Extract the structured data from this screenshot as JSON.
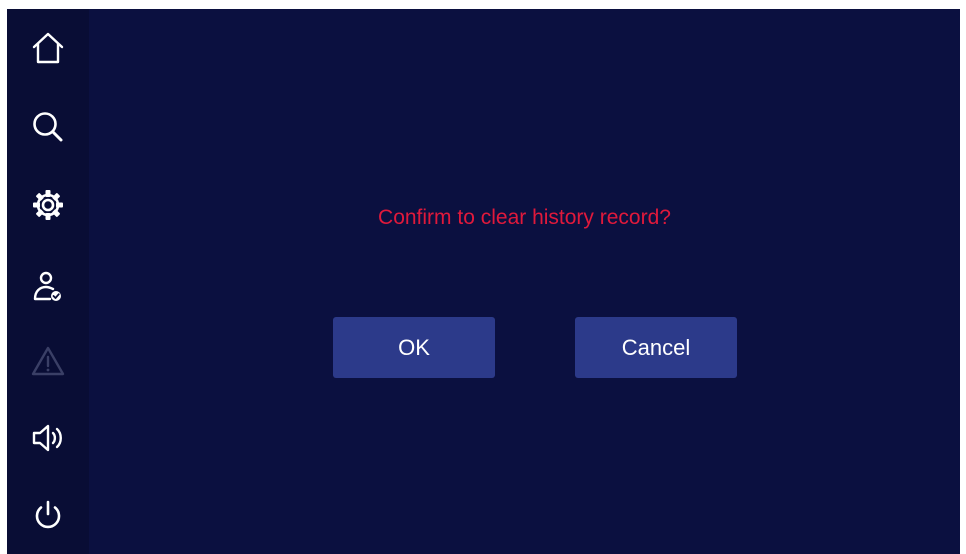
{
  "colors": {
    "background": "#0b1040",
    "sidebar": "#090d35",
    "icon": "#ffffff",
    "icon_disabled": "#3a3f66",
    "message": "#e0193b",
    "button_bg": "#2c3a8a",
    "button_text": "#ffffff"
  },
  "sidebar": {
    "items": [
      {
        "icon": "home-icon",
        "enabled": true
      },
      {
        "icon": "search-icon",
        "enabled": true
      },
      {
        "icon": "gear-icon",
        "enabled": true
      },
      {
        "icon": "user-check-icon",
        "enabled": true
      },
      {
        "icon": "warning-icon",
        "enabled": false
      },
      {
        "icon": "speaker-icon",
        "enabled": true
      },
      {
        "icon": "power-icon",
        "enabled": true
      }
    ]
  },
  "dialog": {
    "message": "Confirm to clear history record?",
    "ok_label": "OK",
    "cancel_label": "Cancel"
  }
}
